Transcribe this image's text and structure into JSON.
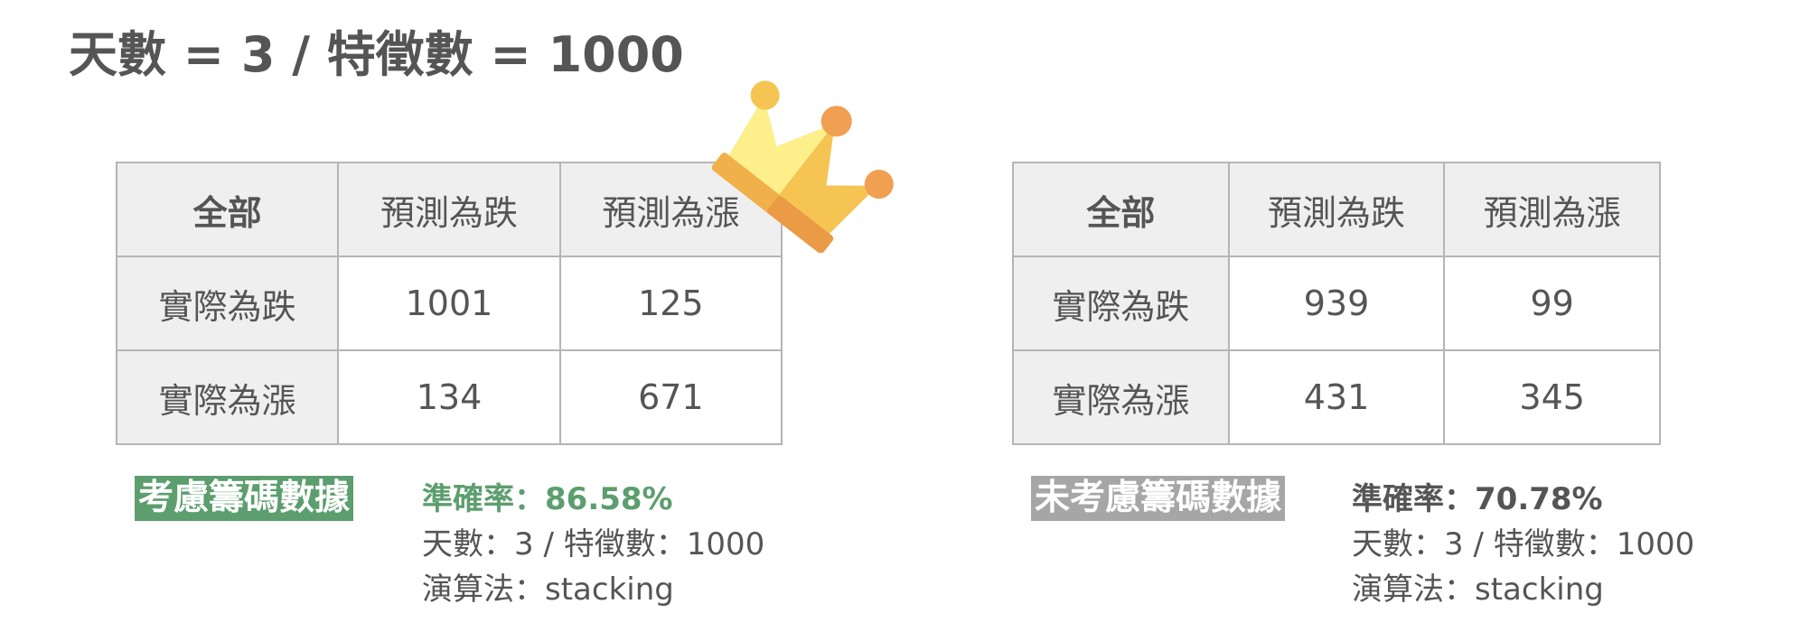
{
  "title": "天數 = 3 / 特徵數 = 1000",
  "left": {
    "tag": "考慮籌碼數據",
    "table": {
      "corner": "全部",
      "col_headers": [
        "預測為跌",
        "預測為漲"
      ],
      "rows": [
        {
          "label": "實際為跌",
          "values": [
            "1001",
            "125"
          ]
        },
        {
          "label": "實際為漲",
          "values": [
            "134",
            "671"
          ]
        }
      ]
    },
    "info": {
      "accuracy": "準確率：86.58%",
      "params": "天數：3  / 特徵數：1000",
      "algorithm": "演算法：stacking"
    }
  },
  "right": {
    "tag": "未考慮籌碼數據",
    "table": {
      "corner": "全部",
      "col_headers": [
        "預測為跌",
        "預測為漲"
      ],
      "rows": [
        {
          "label": "實際為跌",
          "values": [
            "939",
            "99"
          ]
        },
        {
          "label": "實際為漲",
          "values": [
            "431",
            "345"
          ]
        }
      ]
    },
    "info": {
      "accuracy": "準確率：70.78%",
      "params": "天數：3  / 特徵數：1000",
      "algorithm": "演算法：stacking"
    }
  },
  "colors": {
    "highlight_green": "#5c9e6e",
    "tag_gray": "#a6a6a6",
    "text_gray": "#555555",
    "header_bg": "#efefef",
    "crown_yellow": "#f6c453",
    "crown_light": "#fdf08b",
    "crown_orange": "#f0a050"
  },
  "icons": {
    "crown": "crown-icon"
  }
}
